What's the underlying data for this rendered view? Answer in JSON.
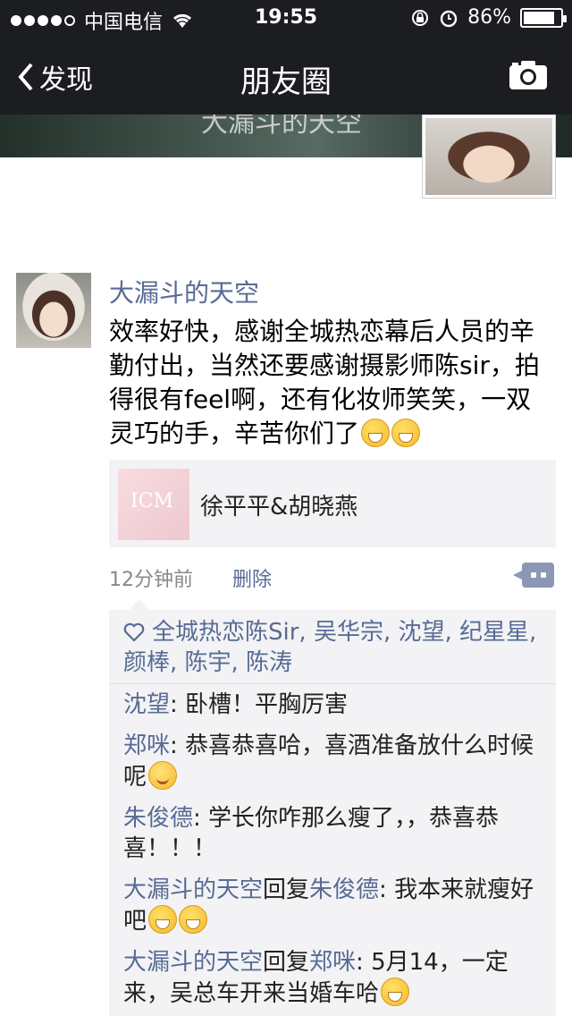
{
  "status_bar": {
    "carrier": "中国电信",
    "time": "19:55",
    "battery": "86%",
    "battery_level": 0.86
  },
  "nav": {
    "back_label": "发现",
    "title": "朋友圈"
  },
  "cover": {
    "owner_name": "大漏斗的天空"
  },
  "post": {
    "author": "大漏斗的天空",
    "text": "效率好快，感谢全城热恋幕后人员的辛勤付出，当然还要感谢摄影师陈sir，拍得很有feel啊，还有化妆师笑笑，一双灵巧的手，辛苦你们了",
    "share_title": "徐平平&胡晓燕",
    "share_thumb_text": "ICM",
    "time_ago": "12分钟前",
    "delete_label": "删除",
    "likes_text": "全城热恋陈Sir, 吴华宗, 沈望, 纪星星, 颜棒, 陈宇, 陈涛"
  },
  "comments": [
    {
      "name": "沈望",
      "text": ": 卧槽！平胸厉害"
    },
    {
      "name": "郑咪",
      "text": ": 恭喜恭喜哈，喜酒准备放什么时候呢"
    },
    {
      "name": "朱俊德",
      "text": ": 学长你咋那么瘦了，，恭喜恭喜！！！"
    },
    {
      "name": "大漏斗的天空",
      "reply_word": "回复",
      "reply_to": "朱俊德",
      "text": ": 我本来就瘦好吧"
    },
    {
      "name": "大漏斗的天空",
      "reply_word": "回复",
      "reply_to": "郑咪",
      "text": ": 5月14，一定来，吴总车开来当婚车哈"
    }
  ]
}
